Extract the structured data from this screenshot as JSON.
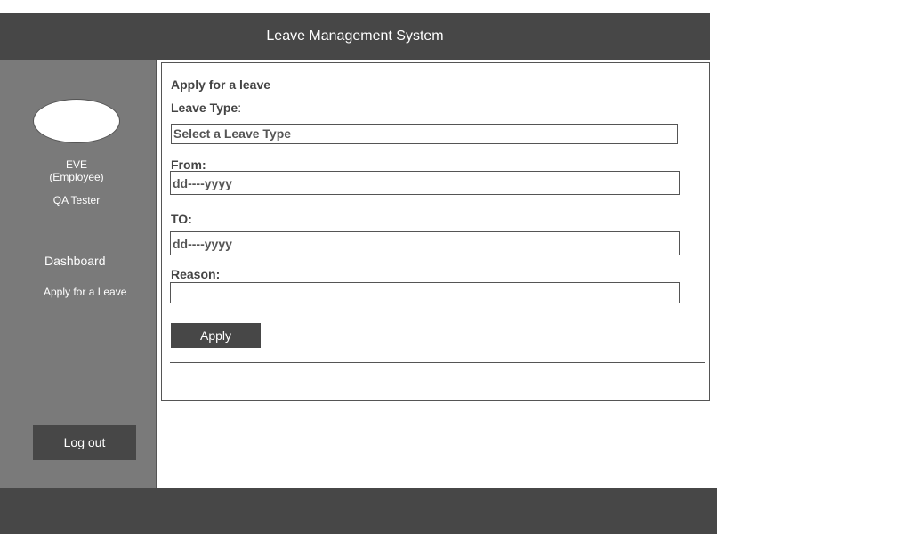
{
  "header": {
    "title": "Leave Management System"
  },
  "sidebar": {
    "user_name": "EVE",
    "user_role": "(Employee)",
    "user_title": "QA Tester",
    "nav": {
      "dashboard": "Dashboard",
      "apply_leave": "Apply for a Leave"
    },
    "logout_label": "Log out"
  },
  "form": {
    "title": "Apply for a leave",
    "leave_type_label": "Leave Type",
    "leave_type_colon": ":",
    "leave_type_selected": "Select a Leave Type",
    "from_label": "From:",
    "from_placeholder": "dd----yyyy",
    "to_label": "TO:",
    "to_placeholder": "dd----yyyy",
    "reason_label": "Reason:",
    "reason_value": "",
    "apply_label": "Apply"
  },
  "colors": {
    "header_bg": "#474747",
    "sidebar_bg": "#7a7a7a",
    "button_bg": "#474747"
  }
}
